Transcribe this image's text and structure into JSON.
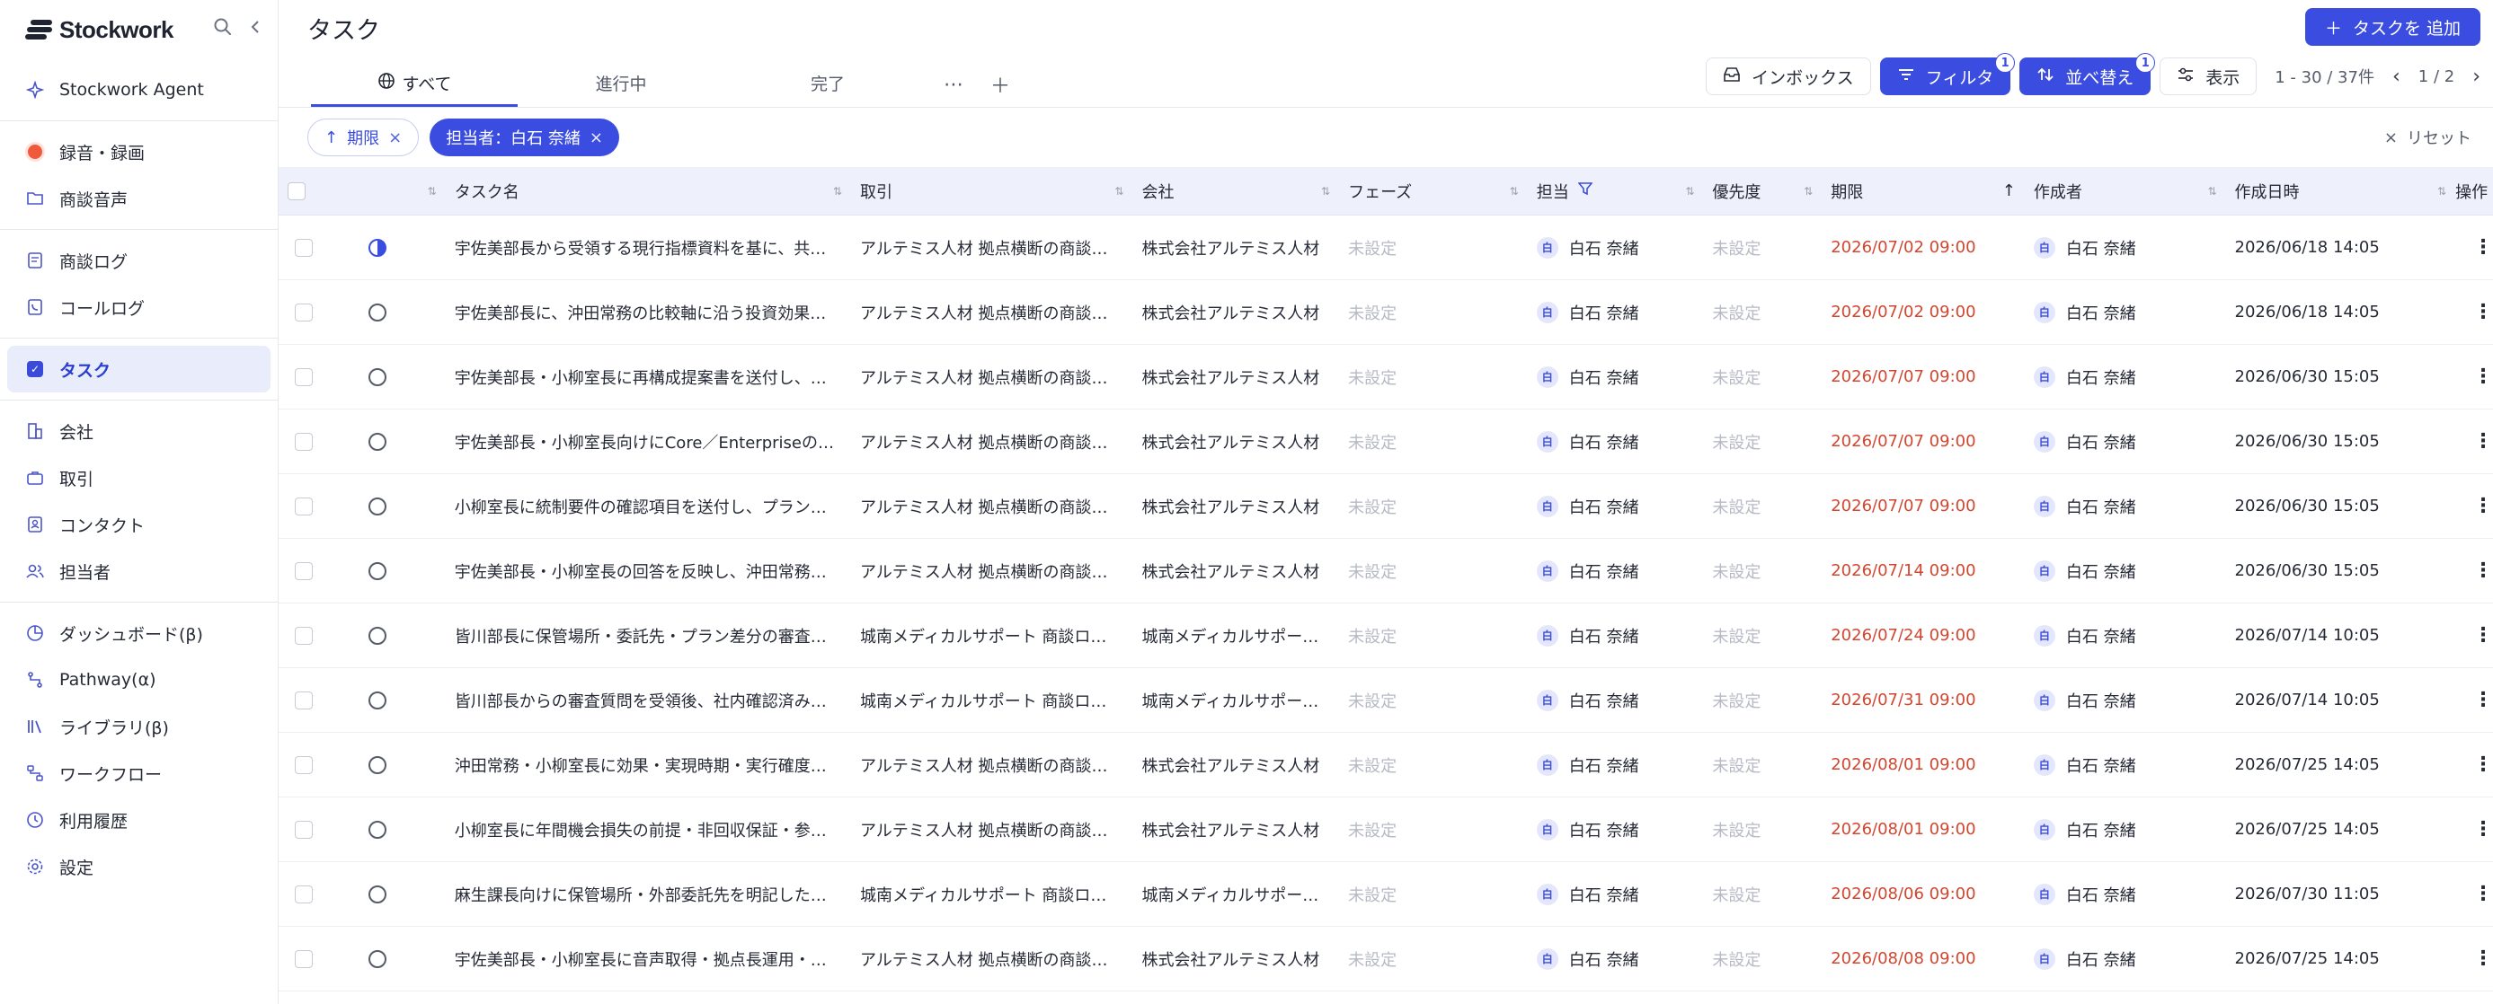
{
  "brand": {
    "name": "Stockwork"
  },
  "sidebar": {
    "groups": [
      [
        {
          "label": "Stockwork Agent",
          "icon": "sparkle-icon"
        }
      ],
      [
        {
          "label": "録音・録画",
          "icon": "record-icon"
        },
        {
          "label": "商談音声",
          "icon": "folder-icon"
        }
      ],
      [
        {
          "label": "商談ログ",
          "icon": "document-icon"
        },
        {
          "label": "コールログ",
          "icon": "phone-log-icon"
        }
      ],
      [
        {
          "label": "タスク",
          "icon": "task-check-icon",
          "active": true
        }
      ],
      [
        {
          "label": "会社",
          "icon": "building-icon"
        },
        {
          "label": "取引",
          "icon": "briefcase-icon"
        },
        {
          "label": "コンタクト",
          "icon": "contact-card-icon"
        },
        {
          "label": "担当者",
          "icon": "users-icon"
        }
      ],
      [
        {
          "label": "ダッシュボード(β)",
          "icon": "dashboard-icon"
        },
        {
          "label": "Pathway(α)",
          "icon": "pathway-icon"
        },
        {
          "label": "ライブラリ(β)",
          "icon": "library-icon"
        },
        {
          "label": "ワークフロー",
          "icon": "workflow-icon"
        },
        {
          "label": "利用履歴",
          "icon": "history-icon"
        },
        {
          "label": "設定",
          "icon": "gear-icon"
        }
      ]
    ]
  },
  "header": {
    "title": "タスク",
    "add_button": "タスクを 追加",
    "tabs": [
      {
        "label": "すべて",
        "active": true
      },
      {
        "label": "進行中"
      },
      {
        "label": "完了"
      }
    ],
    "inbox": "インボックス",
    "filter": {
      "label": "フィルタ",
      "count": "1"
    },
    "sort": {
      "label": "並べ替え",
      "count": "1"
    },
    "view": "表示",
    "range": "1 - 30 / 37件",
    "page": "1 / 2"
  },
  "filters": {
    "chips": [
      {
        "label": "期限",
        "style": "outline"
      },
      {
        "label": "担当者：白石 奈緒",
        "style": "solid"
      }
    ],
    "reset": "リセット"
  },
  "table": {
    "columns": [
      "タスク名",
      "取引",
      "会社",
      "フェーズ",
      "担当",
      "優先度",
      "期限",
      "作成者",
      "作成日時",
      "操作"
    ],
    "rows": [
      {
        "status": "half",
        "name": "宇佐美部長から受領する現行指標資料を基に、共…",
        "deal": "アルテミス人材 拠点横断の商談…",
        "company": "株式会社アルテミス人材",
        "phase": "未設定",
        "owner": "白石 奈緒",
        "avatar": "白",
        "priority": "未設定",
        "due": "2026/07/02 09:00",
        "creator": "白石 奈緒",
        "created": "2026/06/18 14:05"
      },
      {
        "status": "open",
        "name": "宇佐美部長に、沖田常務の比較軸に沿う投資効果…",
        "deal": "アルテミス人材 拠点横断の商談…",
        "company": "株式会社アルテミス人材",
        "phase": "未設定",
        "owner": "白石 奈緒",
        "avatar": "白",
        "priority": "未設定",
        "due": "2026/07/02 09:00",
        "creator": "白石 奈緒",
        "created": "2026/06/18 14:05"
      },
      {
        "status": "open",
        "name": "宇佐美部長・小柳室長に再構成提案書を送付し、…",
        "deal": "アルテミス人材 拠点横断の商談…",
        "company": "株式会社アルテミス人材",
        "phase": "未設定",
        "owner": "白石 奈緒",
        "avatar": "白",
        "priority": "未設定",
        "due": "2026/07/07 09:00",
        "creator": "白石 奈緒",
        "created": "2026/06/30 15:05"
      },
      {
        "status": "open",
        "name": "宇佐美部長・小柳室長向けにCore／Enterpriseの…",
        "deal": "アルテミス人材 拠点横断の商談…",
        "company": "株式会社アルテミス人材",
        "phase": "未設定",
        "owner": "白石 奈緒",
        "avatar": "白",
        "priority": "未設定",
        "due": "2026/07/07 09:00",
        "creator": "白石 奈緒",
        "created": "2026/06/30 15:05"
      },
      {
        "status": "open",
        "name": "小柳室長に統制要件の確認項目を送付し、プラン…",
        "deal": "アルテミス人材 拠点横断の商談…",
        "company": "株式会社アルテミス人材",
        "phase": "未設定",
        "owner": "白石 奈緒",
        "avatar": "白",
        "priority": "未設定",
        "due": "2026/07/07 09:00",
        "creator": "白石 奈緒",
        "created": "2026/06/30 15:05"
      },
      {
        "status": "open",
        "name": "宇佐美部長・小柳室長の回答を反映し、沖田常務…",
        "deal": "アルテミス人材 拠点横断の商談…",
        "company": "株式会社アルテミス人材",
        "phase": "未設定",
        "owner": "白石 奈緒",
        "avatar": "白",
        "priority": "未設定",
        "due": "2026/07/14 09:00",
        "creator": "白石 奈緒",
        "created": "2026/06/30 15:05"
      },
      {
        "status": "open",
        "name": "皆川部長に保管場所・委託先・プラン差分の審査…",
        "deal": "城南メディカルサポート 商談ロ…",
        "company": "城南メディカルサポー…",
        "phase": "未設定",
        "owner": "白石 奈緒",
        "avatar": "白",
        "priority": "未設定",
        "due": "2026/07/24 09:00",
        "creator": "白石 奈緒",
        "created": "2026/07/14 10:05"
      },
      {
        "status": "open",
        "name": "皆川部長からの審査質問を受領後、社内確認済み…",
        "deal": "城南メディカルサポート 商談ロ…",
        "company": "城南メディカルサポー…",
        "phase": "未設定",
        "owner": "白石 奈緒",
        "avatar": "白",
        "priority": "未設定",
        "due": "2026/07/31 09:00",
        "creator": "白石 奈緒",
        "created": "2026/07/14 10:05"
      },
      {
        "status": "open",
        "name": "沖田常務・小柳室長に効果・実現時期・実行確度…",
        "deal": "アルテミス人材 拠点横断の商談…",
        "company": "株式会社アルテミス人材",
        "phase": "未設定",
        "owner": "白石 奈緒",
        "avatar": "白",
        "priority": "未設定",
        "due": "2026/08/01 09:00",
        "creator": "白石 奈緒",
        "created": "2026/07/25 14:05"
      },
      {
        "status": "open",
        "name": "小柳室長に年間機会損失の前提・非回収保証・参…",
        "deal": "アルテミス人材 拠点横断の商談…",
        "company": "株式会社アルテミス人材",
        "phase": "未設定",
        "owner": "白石 奈緒",
        "avatar": "白",
        "priority": "未設定",
        "due": "2026/08/01 09:00",
        "creator": "白石 奈緒",
        "created": "2026/07/25 14:05"
      },
      {
        "status": "open",
        "name": "麻生課長向けに保管場所・外部委託先を明記した…",
        "deal": "城南メディカルサポート 商談ロ…",
        "company": "城南メディカルサポー…",
        "phase": "未設定",
        "owner": "白石 奈緒",
        "avatar": "白",
        "priority": "未設定",
        "due": "2026/08/06 09:00",
        "creator": "白石 奈緒",
        "created": "2026/07/30 11:05"
      },
      {
        "status": "open",
        "name": "宇佐美部長・小柳室長に音声取得・拠点長運用・…",
        "deal": "アルテミス人材 拠点横断の商談…",
        "company": "株式会社アルテミス人材",
        "phase": "未設定",
        "owner": "白石 奈緒",
        "avatar": "白",
        "priority": "未設定",
        "due": "2026/08/08 09:00",
        "creator": "白石 奈緒",
        "created": "2026/07/25 14:05"
      }
    ]
  },
  "colors": {
    "accent": "#3b4de0",
    "due": "#d1462f",
    "active_bg": "#e9ecfb",
    "header_bg": "#eef0fb"
  }
}
